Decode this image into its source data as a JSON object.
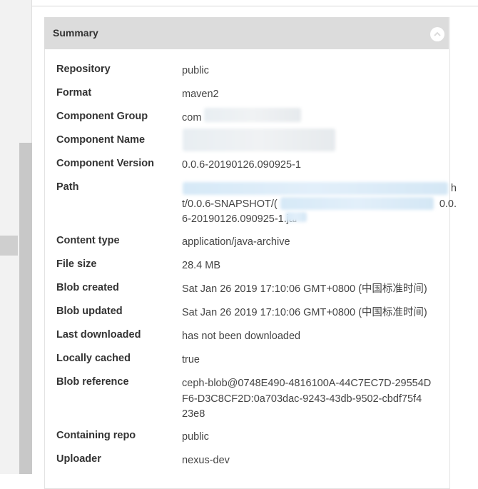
{
  "panel": {
    "title": "Summary",
    "collapse_icon": "chevron-up-icon"
  },
  "rows": [
    {
      "label": "Repository",
      "value": "public"
    },
    {
      "label": "Format",
      "value": "maven2"
    },
    {
      "label": "Component Group",
      "value": "com"
    },
    {
      "label": "Component Name",
      "value": ""
    },
    {
      "label": "Component Version",
      "value": "0.0.6-20190126.090925-1"
    },
    {
      "label": "Path",
      "lines": [
        "h",
        "t/0.0.6-SNAPSHOT/(",
        "0.0.",
        "6-20190126.090925-1.jar"
      ]
    },
    {
      "label": "Content type",
      "value": "application/java-archive"
    },
    {
      "label": "File size",
      "value": "28.4 MB"
    },
    {
      "label": "Blob created",
      "value": "Sat Jan 26 2019 17:10:06 GMT+0800 (中国标准时间)"
    },
    {
      "label": "Blob updated",
      "value": "Sat Jan 26 2019 17:10:06 GMT+0800 (中国标准时间)"
    },
    {
      "label": "Last downloaded",
      "value": "has not been downloaded"
    },
    {
      "label": "Locally cached",
      "value": "true"
    },
    {
      "label": "Blob reference",
      "lines": [
        "ceph-blob@0748E490-4816100A-44C7EC7D-29554D",
        "F6-D3C8CF2D:0a703dac-9243-43db-9502-cbdf75f4",
        "23e8"
      ]
    },
    {
      "label": "Containing repo",
      "value": "public"
    },
    {
      "label": "Uploader",
      "value": "nexus-dev"
    }
  ],
  "colors": {
    "link": "#2b7cc4",
    "header_bg": "#dcdcdc"
  }
}
